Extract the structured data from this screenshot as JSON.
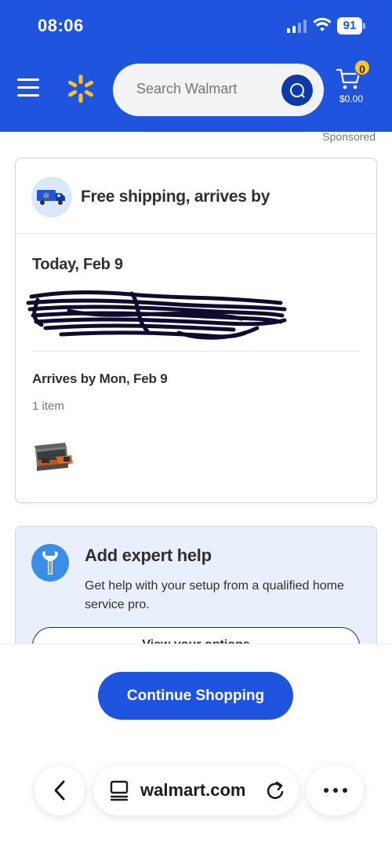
{
  "status_bar": {
    "time": "08:06",
    "battery": "91"
  },
  "header": {
    "search_placeholder": "Search Walmart",
    "cart_count": "0",
    "cart_total": "$0.00",
    "brand_color": "#1f55de",
    "spark_color": "#ffc220"
  },
  "sponsored_label": "Sponsored",
  "delivery_card": {
    "title": "Free shipping, arrives by",
    "date_heading": "Today, Feb 9",
    "arrives_label": "Arrives by Mon, Feb 9",
    "item_count": "1 item",
    "product_icon": "product-thumbnail"
  },
  "help_card": {
    "title": "Add expert help",
    "description": "Get help with your setup from a qualified home service pro.",
    "button_label": "View your options"
  },
  "continue_button": "Continue Shopping",
  "browser": {
    "url": "walmart.com"
  }
}
